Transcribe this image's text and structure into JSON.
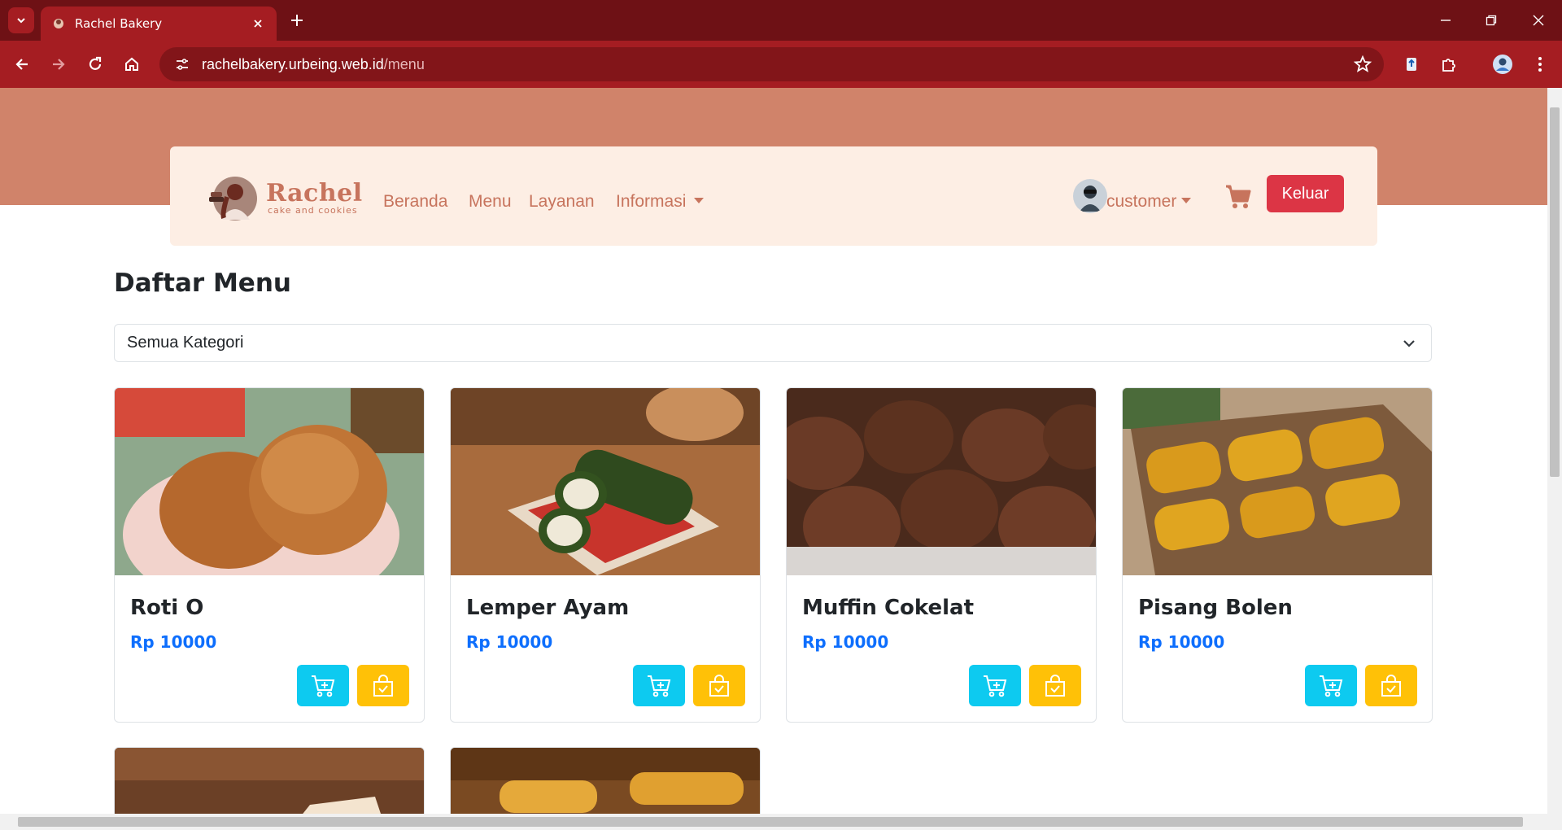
{
  "browser": {
    "tab_title": "Rachel Bakery",
    "url_host": "rachelbakery.urbeing.web.id",
    "url_path": "/menu"
  },
  "navbar": {
    "logo_text": "Rachel",
    "logo_sub": "cake and cookies",
    "links": [
      "Beranda",
      "Menu",
      "Layanan",
      "Informasi"
    ],
    "user_label": "customer",
    "logout_label": "Keluar"
  },
  "main": {
    "title": "Daftar Menu",
    "category_selected": "Semua Kategori",
    "products": [
      {
        "name": "Roti O",
        "price": "Rp 10000"
      },
      {
        "name": "Lemper Ayam",
        "price": "Rp 10000"
      },
      {
        "name": "Muffin Cokelat",
        "price": "Rp 10000"
      },
      {
        "name": "Pisang Bolen",
        "price": "Rp 10000"
      }
    ]
  },
  "colors": {
    "browser_frame": "#6e1115",
    "toolbar": "#a51d22",
    "hero_band": "#d0836a",
    "navbar_bg": "#fdeee4",
    "brand_text": "#c7745d",
    "logout": "#dc3545",
    "price": "#0d6efd",
    "cart_button": "#0dcaf0",
    "buy_button": "#ffc107"
  },
  "icons": [
    "chevron-down-icon",
    "close-icon",
    "plus-icon",
    "back-icon",
    "forward-icon",
    "reload-icon",
    "home-icon",
    "site-settings-icon",
    "star-icon",
    "extensions-icon",
    "profile-icon",
    "menu-dots-icon",
    "cart-icon",
    "cart-plus-icon",
    "bag-check-icon"
  ]
}
